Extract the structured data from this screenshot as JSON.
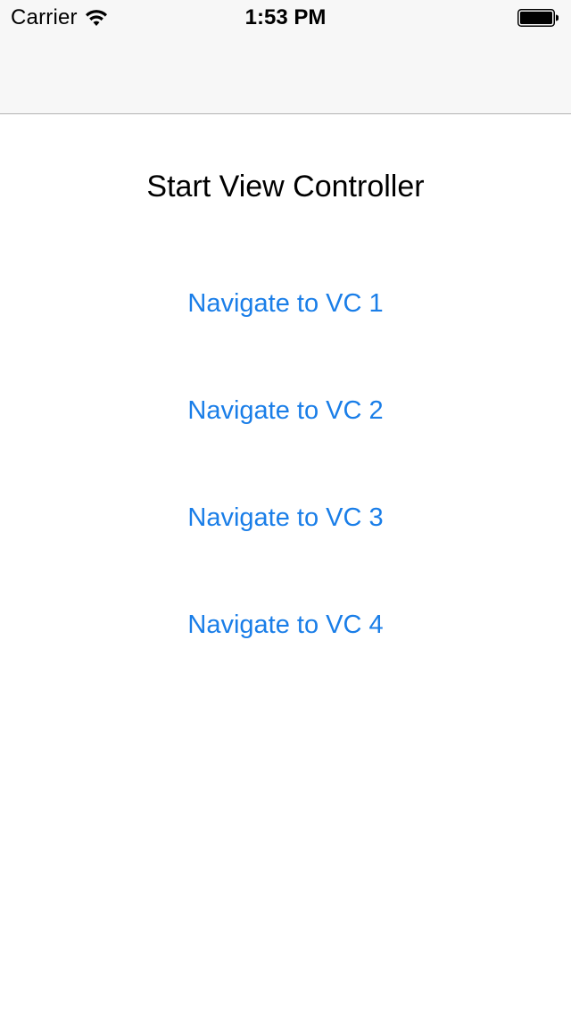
{
  "status_bar": {
    "carrier": "Carrier",
    "time": "1:53 PM",
    "wifi_icon": "wifi-icon",
    "battery_icon": "battery-full-icon",
    "battery_level": 1.0
  },
  "main": {
    "title": "Start View Controller",
    "buttons": [
      {
        "label": "Navigate to VC 1"
      },
      {
        "label": "Navigate to VC 2"
      },
      {
        "label": "Navigate to VC 3"
      },
      {
        "label": "Navigate to VC 4"
      }
    ]
  },
  "colors": {
    "tint": "#1a7ee8",
    "nav_background": "#f7f7f7",
    "background": "#ffffff",
    "text": "#000000"
  }
}
